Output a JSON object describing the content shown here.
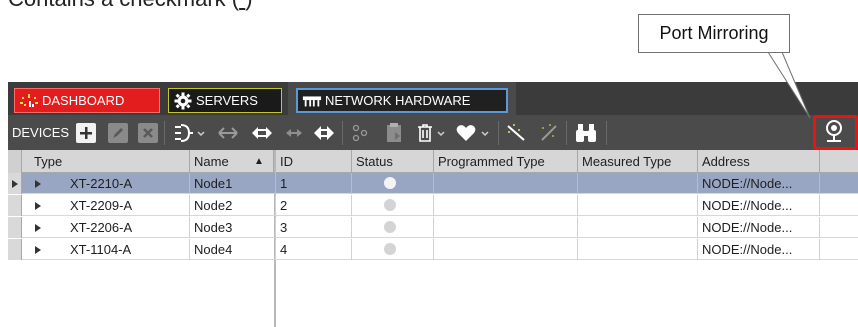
{
  "caption": {
    "prefix": "Contains  a  checkmark  (",
    "underlined": "    ",
    "suffix": ")"
  },
  "callout": {
    "text": "Port Mirroring"
  },
  "tabs": {
    "dashboard": "DASHBOARD",
    "servers": "SERVERS",
    "network": "NETWORK HARDWARE"
  },
  "toolbar": {
    "label": "DEVICES",
    "icons": [
      "add-icon",
      "edit-icon",
      "delete-icon",
      "connector-icon",
      "link-left-icon",
      "link-both-icon",
      "link-small-icon",
      "link-double-icon",
      "network-node-icon",
      "clipboard-icon",
      "trash-menu-icon",
      "heart-menu-icon",
      "wand-icon",
      "wand-disabled-icon",
      "binoculars-icon",
      "port-mirroring-icon"
    ]
  },
  "grid": {
    "columns": [
      "Type",
      "Name",
      "ID",
      "Status",
      "Programmed Type",
      "Measured Type",
      "Address"
    ],
    "sort_indicator": "▲",
    "rows": [
      {
        "type": "XT-2210-A",
        "name": "Node1",
        "id": "1",
        "status": "online",
        "programmed": "",
        "measured": "",
        "address": "NODE://Node...",
        "selected": true
      },
      {
        "type": "XT-2209-A",
        "name": "Node2",
        "id": "2",
        "status": "offline",
        "programmed": "",
        "measured": "",
        "address": "NODE://Node...",
        "selected": false
      },
      {
        "type": "XT-2206-A",
        "name": "Node3",
        "id": "3",
        "status": "offline",
        "programmed": "",
        "measured": "",
        "address": "NODE://Node...",
        "selected": false
      },
      {
        "type": "XT-1104-A",
        "name": "Node4",
        "id": "4",
        "status": "offline",
        "programmed": "",
        "measured": "",
        "address": "NODE://Node...",
        "selected": false
      }
    ]
  },
  "colors": {
    "dashboard_tab": "#e31d1d",
    "servers_border": "#c4c62a",
    "network_border": "#5d98d6",
    "highlight": "#e81414",
    "selected_row": "#98a6c4"
  }
}
